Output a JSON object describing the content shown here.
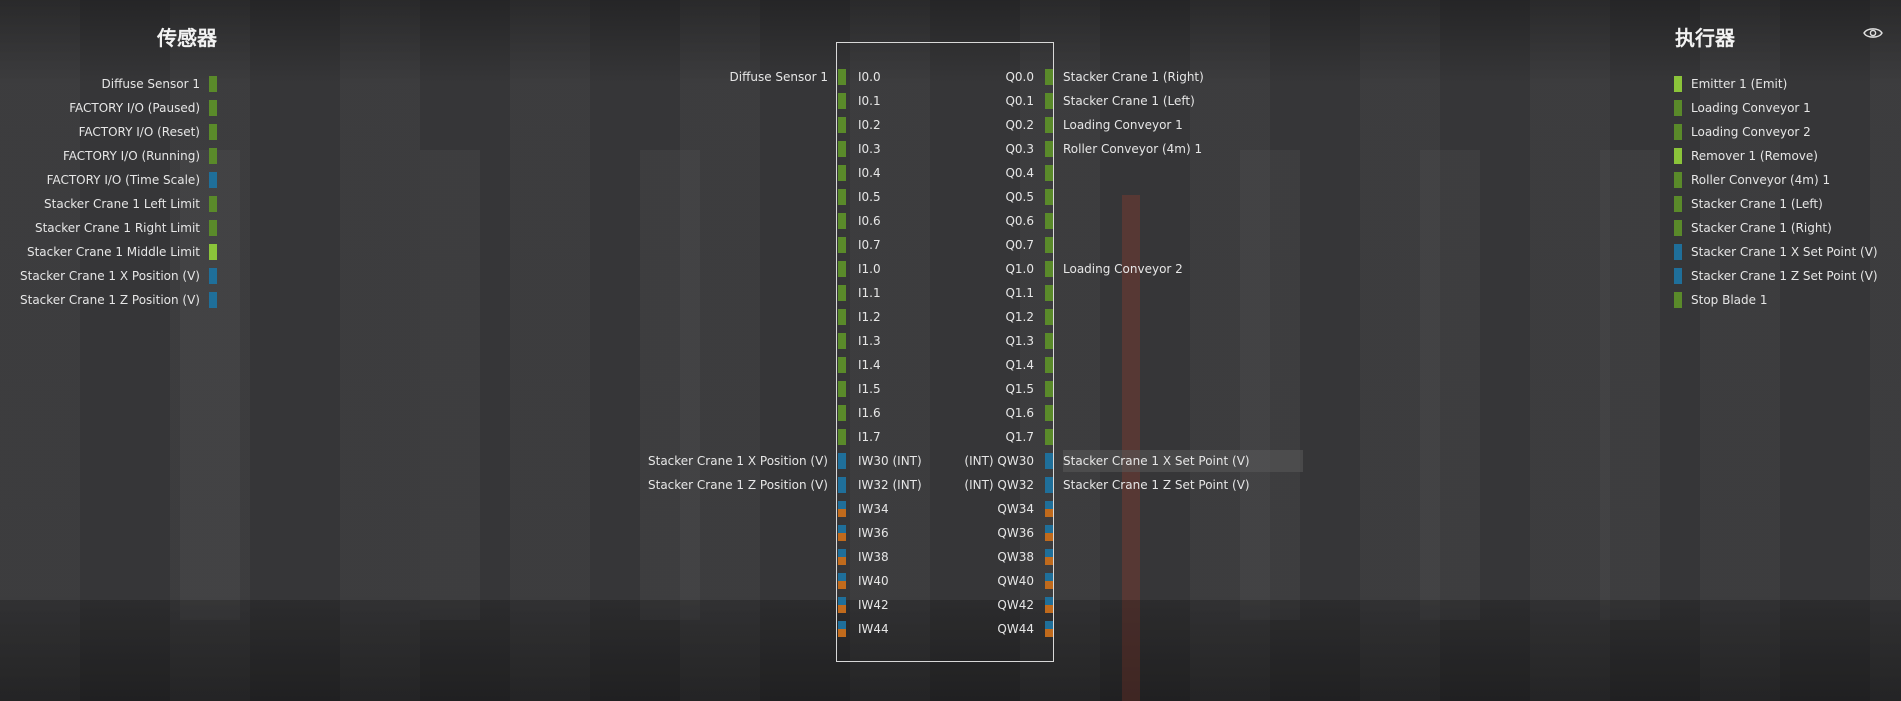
{
  "sensors": {
    "title": "传感器",
    "items": [
      {
        "label": "Diffuse Sensor 1",
        "kind": "bool"
      },
      {
        "label": "FACTORY I/O (Paused)",
        "kind": "bool"
      },
      {
        "label": "FACTORY I/O (Reset)",
        "kind": "bool"
      },
      {
        "label": "FACTORY I/O (Running)",
        "kind": "bool"
      },
      {
        "label": "FACTORY I/O (Time Scale)",
        "kind": "num"
      },
      {
        "label": "Stacker Crane 1 Left Limit",
        "kind": "bool"
      },
      {
        "label": "Stacker Crane 1 Right Limit",
        "kind": "bool"
      },
      {
        "label": "Stacker Crane 1 Middle Limit",
        "kind": "bool-on"
      },
      {
        "label": "Stacker Crane 1 X Position (V)",
        "kind": "num"
      },
      {
        "label": "Stacker Crane 1 Z Position (V)",
        "kind": "num"
      }
    ]
  },
  "actuators": {
    "title": "执行器",
    "items": [
      {
        "label": "Emitter 1 (Emit)",
        "kind": "bool-on"
      },
      {
        "label": "Loading Conveyor 1",
        "kind": "bool"
      },
      {
        "label": "Loading Conveyor 2",
        "kind": "bool"
      },
      {
        "label": "Remover 1 (Remove)",
        "kind": "bool-on"
      },
      {
        "label": "Roller Conveyor (4m) 1",
        "kind": "bool"
      },
      {
        "label": "Stacker Crane 1 (Left)",
        "kind": "bool"
      },
      {
        "label": "Stacker Crane 1 (Right)",
        "kind": "bool"
      },
      {
        "label": "Stacker Crane 1 X Set Point (V)",
        "kind": "num"
      },
      {
        "label": "Stacker Crane 1 Z Set Point (V)",
        "kind": "num"
      },
      {
        "label": "Stop Blade 1",
        "kind": "bool"
      }
    ]
  },
  "visibility_icon": "eye-icon",
  "plc": {
    "rows": [
      {
        "in": "I0.0",
        "in_tag": "Diffuse Sensor 1",
        "out": "Q0.0",
        "out_tag": "Stacker Crane 1 (Right)",
        "kind": "bool"
      },
      {
        "in": "I0.1",
        "in_tag": "",
        "out": "Q0.1",
        "out_tag": "Stacker Crane 1 (Left)",
        "kind": "bool"
      },
      {
        "in": "I0.2",
        "in_tag": "",
        "out": "Q0.2",
        "out_tag": "Loading Conveyor 1",
        "kind": "bool"
      },
      {
        "in": "I0.3",
        "in_tag": "",
        "out": "Q0.3",
        "out_tag": "Roller Conveyor (4m) 1",
        "kind": "bool"
      },
      {
        "in": "I0.4",
        "in_tag": "",
        "out": "Q0.4",
        "out_tag": "",
        "kind": "bool"
      },
      {
        "in": "I0.5",
        "in_tag": "",
        "out": "Q0.5",
        "out_tag": "",
        "kind": "bool"
      },
      {
        "in": "I0.6",
        "in_tag": "",
        "out": "Q0.6",
        "out_tag": "",
        "kind": "bool"
      },
      {
        "in": "I0.7",
        "in_tag": "",
        "out": "Q0.7",
        "out_tag": "",
        "kind": "bool"
      },
      {
        "in": "I1.0",
        "in_tag": "",
        "out": "Q1.0",
        "out_tag": "Loading Conveyor 2",
        "kind": "bool"
      },
      {
        "in": "I1.1",
        "in_tag": "",
        "out": "Q1.1",
        "out_tag": "",
        "kind": "bool"
      },
      {
        "in": "I1.2",
        "in_tag": "",
        "out": "Q1.2",
        "out_tag": "",
        "kind": "bool"
      },
      {
        "in": "I1.3",
        "in_tag": "",
        "out": "Q1.3",
        "out_tag": "",
        "kind": "bool"
      },
      {
        "in": "I1.4",
        "in_tag": "",
        "out": "Q1.4",
        "out_tag": "",
        "kind": "bool"
      },
      {
        "in": "I1.5",
        "in_tag": "",
        "out": "Q1.5",
        "out_tag": "",
        "kind": "bool"
      },
      {
        "in": "I1.6",
        "in_tag": "",
        "out": "Q1.6",
        "out_tag": "",
        "kind": "bool"
      },
      {
        "in": "I1.7",
        "in_tag": "",
        "out": "Q1.7",
        "out_tag": "",
        "kind": "bool"
      },
      {
        "in": "IW30 (INT)",
        "in_tag": "Stacker Crane 1 X Position (V)",
        "out": "(INT) QW30",
        "out_tag": "Stacker Crane 1 X Set Point (V)",
        "kind": "num",
        "highlight": true
      },
      {
        "in": "IW32 (INT)",
        "in_tag": "Stacker Crane 1 Z Position (V)",
        "out": "(INT) QW32",
        "out_tag": "Stacker Crane 1 Z Set Point (V)",
        "kind": "num"
      },
      {
        "in": "IW34",
        "in_tag": "",
        "out": "QW34",
        "out_tag": "",
        "kind": "split"
      },
      {
        "in": "IW36",
        "in_tag": "",
        "out": "QW36",
        "out_tag": "",
        "kind": "split"
      },
      {
        "in": "IW38",
        "in_tag": "",
        "out": "QW38",
        "out_tag": "",
        "kind": "split"
      },
      {
        "in": "IW40",
        "in_tag": "",
        "out": "QW40",
        "out_tag": "",
        "kind": "split"
      },
      {
        "in": "IW42",
        "in_tag": "",
        "out": "QW42",
        "out_tag": "",
        "kind": "split"
      },
      {
        "in": "IW44",
        "in_tag": "",
        "out": "QW44",
        "out_tag": "",
        "kind": "split"
      }
    ]
  },
  "colors": {
    "bool": "#5a8a2a",
    "bool_on": "#8bc43a",
    "num": "#1f6f9a",
    "split_bottom": "#c06a1c"
  }
}
